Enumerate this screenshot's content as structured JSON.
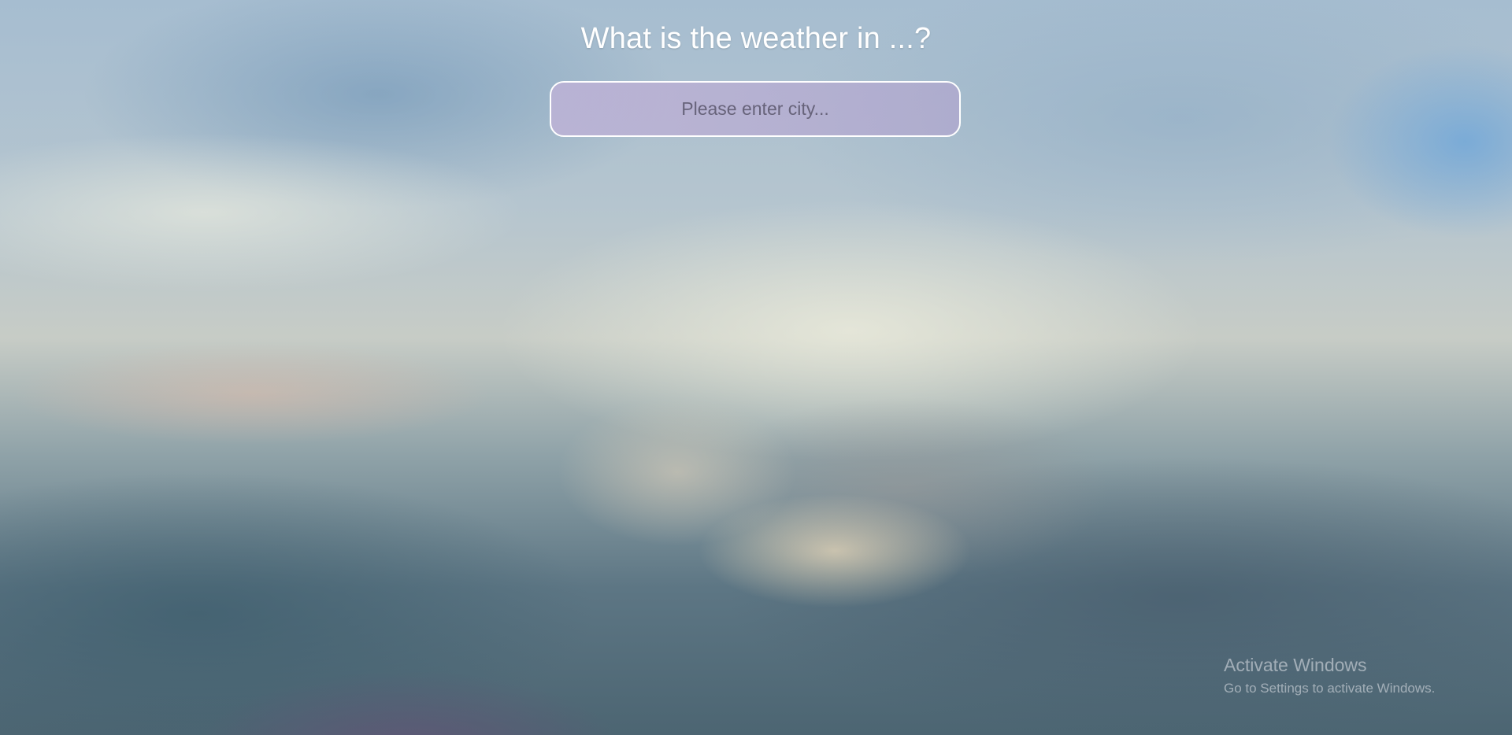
{
  "header": {
    "title": "What is the weather in ...?"
  },
  "search": {
    "placeholder": "Please enter city...",
    "value": ""
  },
  "watermark": {
    "title": "Activate Windows",
    "subtitle": "Go to Settings to activate Windows."
  },
  "colors": {
    "title_text": "#ffffff",
    "input_border": "#ffffff",
    "input_fill": "#b8aed2"
  }
}
